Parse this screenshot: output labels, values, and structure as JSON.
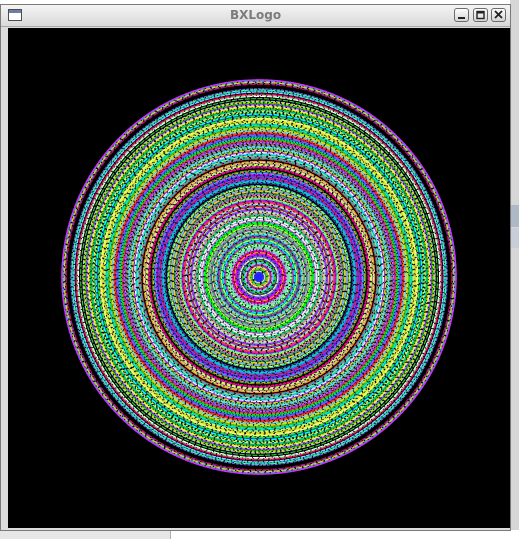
{
  "window": {
    "title": "BXLogo",
    "icons": {
      "app": "window-app-icon",
      "minimize": "minimize-icon",
      "maximize": "maximize-icon",
      "close": "close-icon"
    }
  },
  "canvas": {
    "background": "#000000",
    "drawing": "concentric-rings",
    "palette": [
      "#ff00ff",
      "#00ff00",
      "#ffff66",
      "#00ffff",
      "#ff3333",
      "#3333ff",
      "#ffffff",
      "#ff66cc",
      "#66ff99",
      "#cc99ff",
      "#ff9933",
      "#99ccff",
      "#33cc33",
      "#ff0066",
      "#00cccc",
      "#ffcc00",
      "#6666ff",
      "#ccff66",
      "#000000",
      "#9933ff"
    ]
  }
}
